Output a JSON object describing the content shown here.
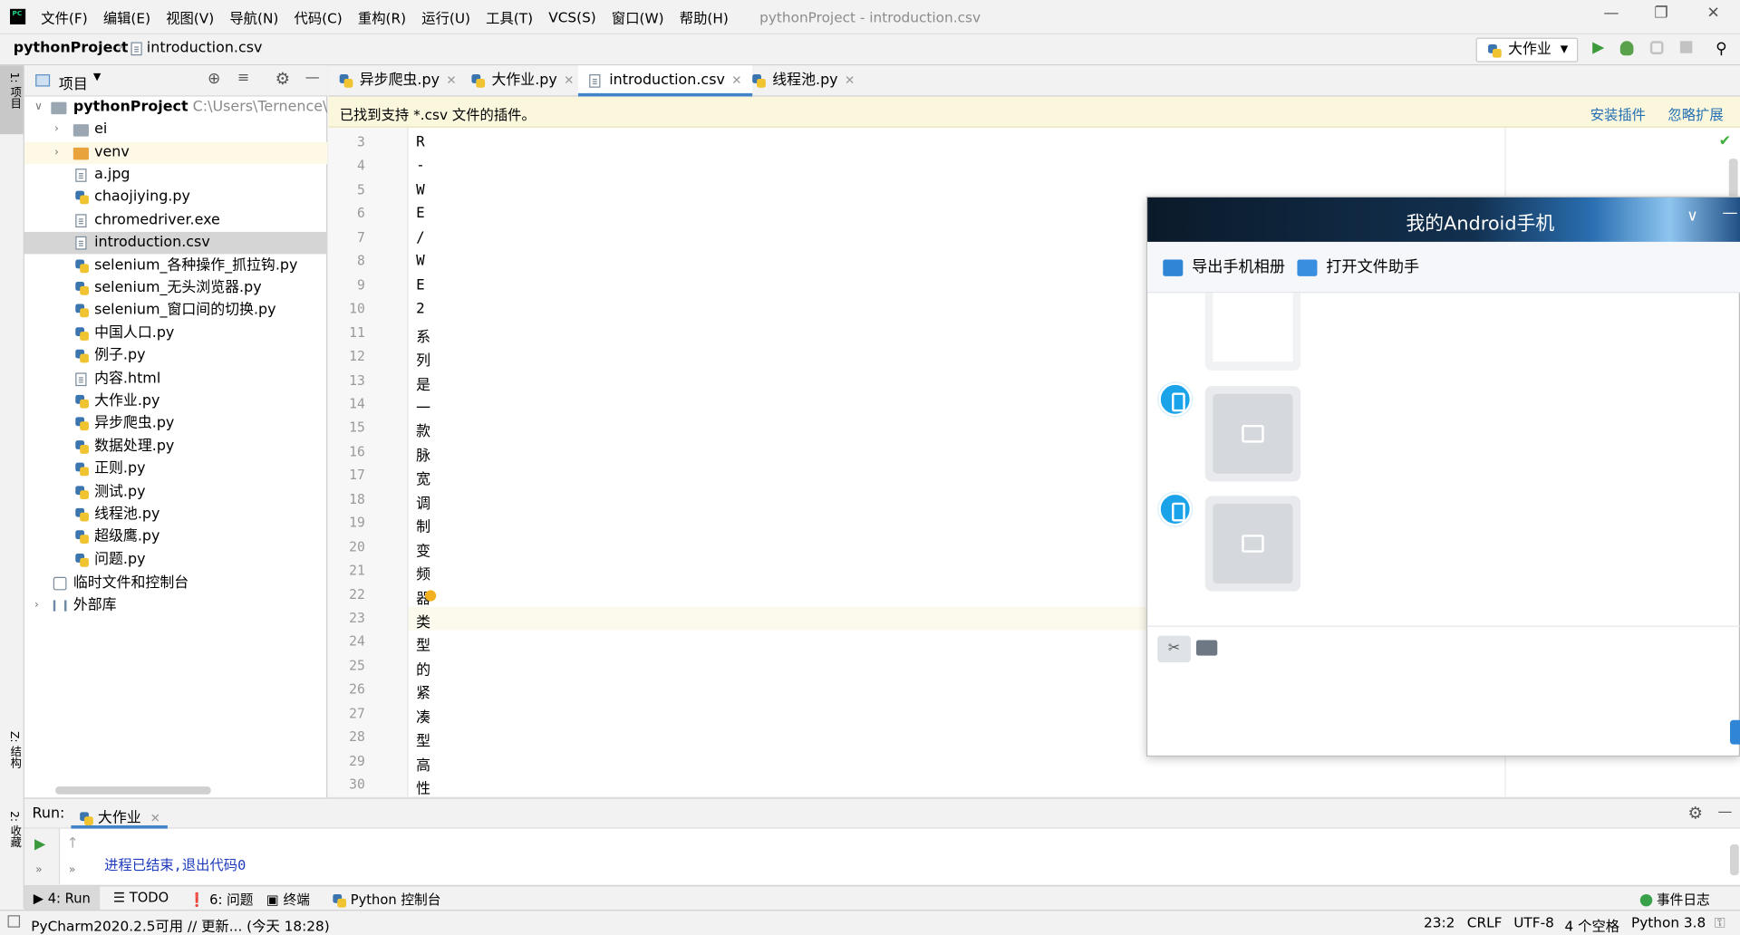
{
  "menubar": {
    "items": [
      "文件(F)",
      "编辑(E)",
      "视图(V)",
      "导航(N)",
      "代码(C)",
      "重构(R)",
      "运行(U)",
      "工具(T)",
      "VCS(S)",
      "窗口(W)",
      "帮助(H)"
    ],
    "window_title": "pythonProject - introduction.csv"
  },
  "navbar": {
    "project": "pythonProject",
    "file": "introduction.csv",
    "run_config": "大作业"
  },
  "left_strip": {
    "project_tab": "1: 项目",
    "structure_tab": "Z: 结构",
    "favorites_tab": "2: 收藏"
  },
  "project_panel": {
    "title": "项目",
    "root_name": "pythonProject",
    "root_path": "C:\\Users\\Ternence\\Pyc",
    "items": [
      {
        "label": "ei"
      },
      {
        "label": "venv"
      },
      {
        "label": "a.jpg"
      },
      {
        "label": "chaojiying.py"
      },
      {
        "label": "chromedriver.exe"
      },
      {
        "label": "introduction.csv"
      },
      {
        "label": "selenium_各种操作_抓拉钩.py"
      },
      {
        "label": "selenium_无头浏览器.py"
      },
      {
        "label": "selenium_窗口间的切换.py"
      },
      {
        "label": "中国人口.py"
      },
      {
        "label": "例子.py"
      },
      {
        "label": "内容.html"
      },
      {
        "label": "大作业.py"
      },
      {
        "label": "异步爬虫.py"
      },
      {
        "label": "数据处理.py"
      },
      {
        "label": "正则.py"
      },
      {
        "label": "测试.py"
      },
      {
        "label": "线程池.py"
      },
      {
        "label": "超级鹰.py"
      },
      {
        "label": "问题.py"
      }
    ],
    "scratches": "临时文件和控制台",
    "external_libs": "外部库"
  },
  "editor_tabs": [
    {
      "label": "异步爬虫.py"
    },
    {
      "label": "大作业.py"
    },
    {
      "label": "introduction.csv"
    },
    {
      "label": "线程池.py"
    }
  ],
  "banner": {
    "text": "已找到支持 *.csv 文件的插件。",
    "install": "安装插件",
    "ignore": "忽略扩展"
  },
  "editor": {
    "line_numbers": [
      "3",
      "4",
      "5",
      "6",
      "7",
      "8",
      "9",
      "10",
      "11",
      "12",
      "13",
      "14",
      "15",
      "16",
      "17",
      "18",
      "19",
      "20",
      "21",
      "22",
      "23",
      "24",
      "25",
      "26",
      "27",
      "28",
      "29",
      "30"
    ],
    "lines": [
      "R",
      "-",
      "W",
      "E",
      "/",
      "W",
      "E",
      "2",
      "系",
      "列",
      "是",
      "一",
      "款",
      "脉",
      "宽",
      "调",
      "制",
      "变",
      "频",
      "器",
      "类",
      "型",
      "的",
      "紧",
      "凑",
      "型",
      "高",
      "性"
    ]
  },
  "phone": {
    "title": "我的Android手机",
    "export_album": "导出手机相册",
    "open_helper": "打开文件助手"
  },
  "run": {
    "label": "Run:",
    "tab": "大作业",
    "message": "进程已结束,退出代码0"
  },
  "tooltabs": {
    "run": "4: Run",
    "todo": "TODO",
    "problems": "6: 问题",
    "terminal": "终端",
    "python_console": "Python 控制台",
    "event_log": "事件日志"
  },
  "statusbar": {
    "update": "PyCharm2020.2.5可用 // 更新... (今天 18:28)",
    "position": "23:2",
    "line_sep": "CRLF",
    "encoding": "UTF-8",
    "indent": "4 个空格",
    "interpreter": "Python 3.8"
  }
}
